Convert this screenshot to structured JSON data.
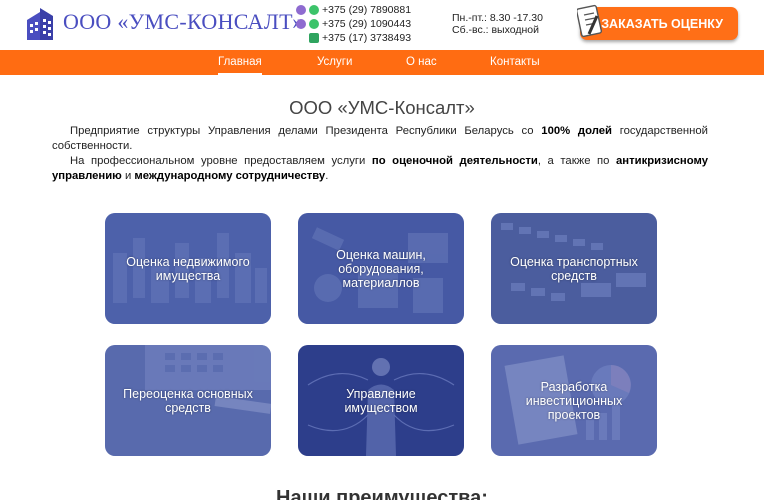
{
  "header": {
    "brand": "ООО «УМС-КОНСАЛТ»",
    "phones": [
      "+375 (29) 7890881",
      "+375 (29) 1090443",
      "+375 (17) 3738493"
    ],
    "hours": [
      "Пн.-пт.: 8.30 -17.30",
      "Сб.-вс.: выходной"
    ],
    "order_button": "ЗАКАЗАТЬ ОЦЕНКУ"
  },
  "nav": {
    "items": [
      {
        "label": "Главная",
        "active": true
      },
      {
        "label": "Услуги",
        "active": false
      },
      {
        "label": "О нас",
        "active": false
      },
      {
        "label": "Контакты",
        "active": false
      }
    ]
  },
  "main": {
    "title": "ООО «УМС-Консалт»",
    "intro": {
      "p1_a": "Предприятие структуры Управления делами Президента Республики Беларусь со ",
      "p1_b": "100% долей",
      "p1_c": " государственной собственности.",
      "p2_a": "На профессиональном уровне предоставляем услуги ",
      "p2_b": "по оценочной деятельности",
      "p2_c": ", а также по ",
      "p2_d": "антикризисному управлению",
      "p2_e": " и ",
      "p2_f": "международному сотрудничеству",
      "p2_g": "."
    },
    "services": [
      {
        "label": "Оценка недвижимого имущества"
      },
      {
        "label": "Оценка машин, оборудования, материаллов"
      },
      {
        "label": "Оценка транспортных средств"
      },
      {
        "label": "Переоценка основных средств"
      },
      {
        "label": "Управление имуществом"
      },
      {
        "label": "Разработка инвестиционных проектов"
      }
    ],
    "advantages_title": "Наши преимущества:"
  },
  "colors": {
    "accent": "#ff6c12",
    "brand": "#4a4ec0",
    "card_overlay": "#3d4f9e"
  }
}
